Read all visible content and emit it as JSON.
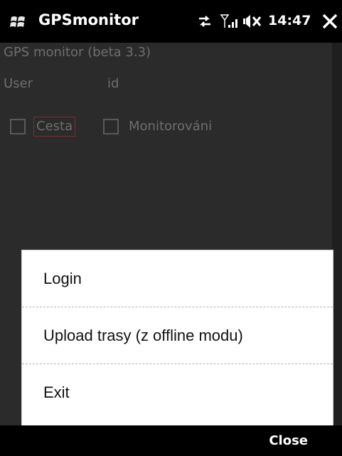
{
  "titlebar": {
    "app_title": "GPSmonitor",
    "time": "14:47",
    "icons": [
      "windows-logo-icon",
      "connectivity-icon",
      "signal-icon",
      "volume-muted-icon",
      "close-icon"
    ]
  },
  "content": {
    "version": "GPS monitor (beta 3.3)",
    "user_label": "User",
    "user_id": "id",
    "checkbox_cesta": "Cesta",
    "checkbox_monitoring": "Monitorováni"
  },
  "menu": {
    "items": [
      "Login",
      "Upload trasy (z offline modu)",
      "Exit"
    ]
  },
  "softkeys": {
    "right": "Close"
  },
  "colors": {
    "background_dim": "#2b2b2b",
    "menu_bg": "#ffffff",
    "bar_bg": "#000000"
  }
}
